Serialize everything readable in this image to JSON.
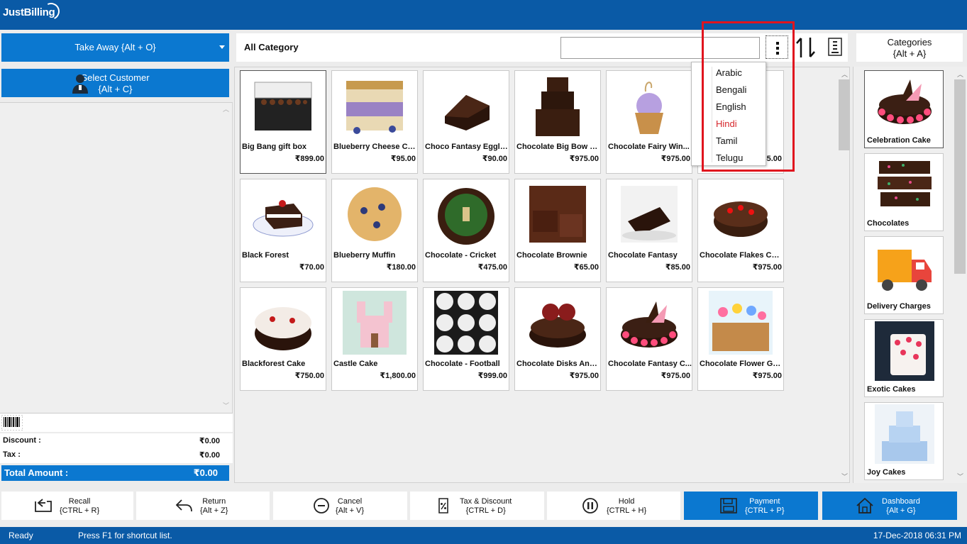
{
  "app": {
    "title": "JustBilling"
  },
  "left": {
    "order_type": "Take Away {Alt + O}",
    "customer_line1": "Select Customer",
    "customer_line2": "{Alt + C}",
    "discount_label": "Discount :",
    "discount_value": "₹0.00",
    "tax_label": "Tax :",
    "tax_value": "₹0.00",
    "total_label": "Total Amount :",
    "total_value": "₹0.00"
  },
  "center": {
    "category_title": "All Category",
    "search_value": "",
    "categories_btn_line1": "Categories",
    "categories_btn_line2": "{Alt + A}"
  },
  "products": [
    {
      "name": "Big Bang gift box",
      "price": "₹899.00"
    },
    {
      "name": "Blueberry Cheese Ca...",
      "price": "₹95.00"
    },
    {
      "name": "Choco Fantasy Eggle...",
      "price": "₹90.00"
    },
    {
      "name": "Chocolate Big Bow C...",
      "price": "₹975.00"
    },
    {
      "name": "Chocolate Fairy Win...",
      "price": "₹975.00"
    },
    {
      "name": "",
      "price": "₹85.00"
    },
    {
      "name": "Black Forest",
      "price": "₹70.00"
    },
    {
      "name": "Blueberry Muffin",
      "price": "₹180.00"
    },
    {
      "name": "Chocolate - Cricket",
      "price": "₹475.00"
    },
    {
      "name": "Chocolate Brownie",
      "price": "₹65.00"
    },
    {
      "name": "Chocolate Fantasy",
      "price": "₹85.00"
    },
    {
      "name": "Chocolate Flakes Cake",
      "price": "₹975.00"
    },
    {
      "name": "Blackforest Cake",
      "price": "₹750.00"
    },
    {
      "name": "Castle Cake",
      "price": "₹1,800.00"
    },
    {
      "name": "Chocolate - Football",
      "price": "₹999.00"
    },
    {
      "name": "Chocolate Disks And...",
      "price": "₹975.00"
    },
    {
      "name": "Chocolate Fantasy C...",
      "price": "₹975.00"
    },
    {
      "name": "Chocolate Flower Ga...",
      "price": "₹975.00"
    }
  ],
  "categories": [
    {
      "name": "Celebration Cake"
    },
    {
      "name": "Chocolates"
    },
    {
      "name": "Delivery Charges"
    },
    {
      "name": "Exotic Cakes"
    },
    {
      "name": "Joy Cakes"
    }
  ],
  "language_menu": {
    "items": [
      "Arabic",
      "Bengali",
      "English",
      "Hindi",
      "Tamil",
      "Telugu"
    ],
    "active": "Hindi"
  },
  "actions": [
    {
      "label": "Recall",
      "shortcut": "{CTRL + R}",
      "icon": "recall-icon"
    },
    {
      "label": "Return",
      "shortcut": "{Alt + Z}",
      "icon": "return-icon"
    },
    {
      "label": "Cancel",
      "shortcut": "{Alt + V}",
      "icon": "cancel-icon"
    },
    {
      "label": "Tax & Discount",
      "shortcut": "{CTRL + D}",
      "icon": "tax-discount-icon"
    },
    {
      "label": "Hold",
      "shortcut": "{CTRL + H}",
      "icon": "hold-icon"
    },
    {
      "label": "Payment",
      "shortcut": "{CTRL + P}",
      "icon": "payment-icon"
    },
    {
      "label": "Dashboard",
      "shortcut": "{Alt + G}",
      "icon": "dashboard-icon"
    }
  ],
  "status": {
    "ready": "Ready",
    "hint": "Press F1 for shortcut list.",
    "datetime": "17-Dec-2018 06:31 PM"
  },
  "colors": {
    "primary": "#0b78d0",
    "titlebar": "#0a5aa6",
    "active_language": "#d6262b",
    "highlight": "#e0141e"
  }
}
